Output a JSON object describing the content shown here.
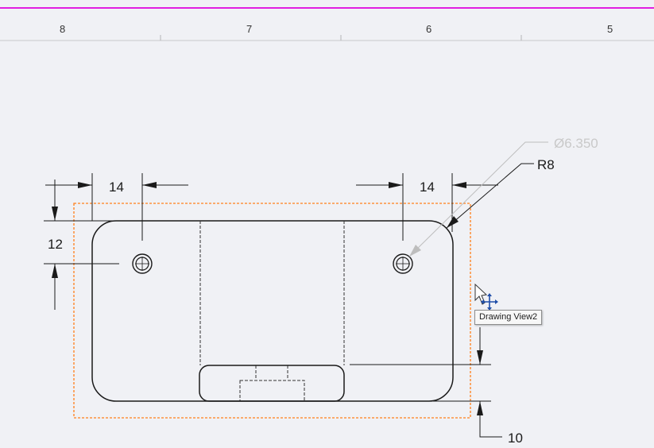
{
  "sheet": {
    "border_color": "#e11ee1",
    "zone_labels": [
      "8",
      "7",
      "6",
      "5"
    ]
  },
  "view": {
    "selection_color": "#ff7f1a",
    "tooltip": "Drawing View2"
  },
  "dimensions": {
    "left_hole_offset": "14",
    "right_hole_offset": "14",
    "hole_vertical_offset": "12",
    "hole_diameter": "Ø6.350",
    "corner_radius": "R8",
    "bottom_offset": "10"
  },
  "colors": {
    "geometry": "#1a1a1a",
    "preview_leader": "#bdbdbd"
  }
}
